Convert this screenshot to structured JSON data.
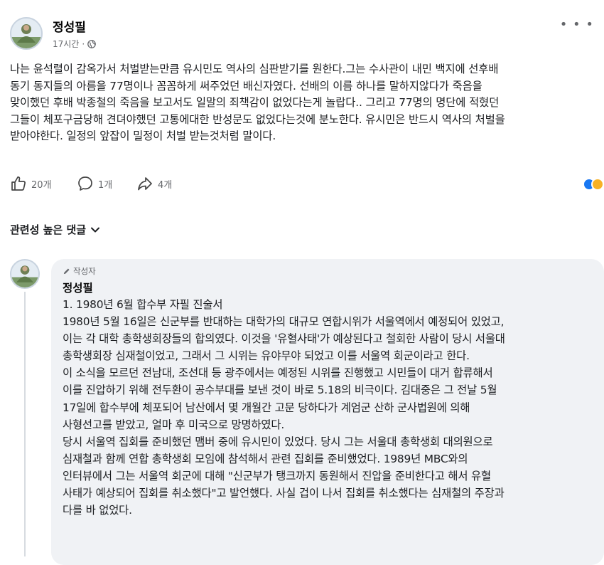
{
  "post": {
    "author": "정성필",
    "time": "17시간",
    "separator": "·",
    "privacy_icon": "globe-icon",
    "more_icon": "more-dots-icon",
    "body": "나는 윤석렬이 감옥가서 처벌받는만큼 유시민도 역사의 심판받기를 원한다.그는 수사관이 내민 백지에 선후배\n동기 동지들의 아름을 77명이나 꼼꼼하게 써주었던 배신자였다.  선배의 이름 하나를 말하지않다가 죽음을\n맞이했던 후배 박종철의 죽음을 보고서도 일말의 죄책감이 없었다는게 놀랍다.. 그리고 77명의 명단에 적혔던\n그들이 체포구금당해 견뎌야했던 고통에대한 반성문도 없었다는것에  분노한다. 유시민은 반드시 역사의 처벌을\n받아야한다. 일정의 앞잡이 밀정이 처벌 받는것처럼 말이다."
  },
  "actions": {
    "like_count": "20개",
    "comment_count": "1개",
    "share_count": "4개"
  },
  "reactions": {
    "like_color": "#1877f2",
    "sad_color": "#f7b125"
  },
  "comments": {
    "sort_label": "관련성 높은 댓글"
  },
  "comment": {
    "badge": "작성자",
    "author": "정성필",
    "text": "1. 1980년 6월 합수부 자필 진술서\n1980년 5월 16일은 신군부를 반대하는 대학가의 대규모 연합시위가 서울역에서 예정되어 있었고,\n이는 각 대학 총학생회장들의 합의였다. 이것을 '유혈사태'가 예상된다고 철회한 사람이 당시 서울대\n총학생회장 심재철이었고, 그래서 그 시위는 유야무야 되었고 이를 서울역 회군이라고 한다.\n이 소식을 모르던 전남대, 조선대 등 광주에서는 예정된 시위를 진행했고 시민들이 대거 합류해서\n이를 진압하기 위해 전두환이 공수부대를 보낸 것이 바로 5.18의 비극이다. 김대중은 그 전날 5월\n17일에 합수부에 체포되어 남산에서 몇 개월간 고문 당하다가 계엄군 산하 군사법원에 의해\n사형선고를 받았고, 얼마 후 미국으로 망명하였다.\n당시 서울역 집회를 준비했던 맴버 중에 유시민이 있었다. 당시 그는 서울대 총학생회 대의원으로\n심재철과 함께 연합 총학생회 모임에 참석해서 관련 집회를 준비했었다. 1989년 MBC와의\n인터뷰에서 그는 서울역 회군에 대해 \"신군부가 탱크까지 동원해서 진압을 준비한다고 해서 유혈\n사태가 예상되어 집회를 취소했다\"고 발언했다. 사실 겁이 나서 집회를 취소했다는 심재철의 주장과\n다를 바 없었다."
  }
}
